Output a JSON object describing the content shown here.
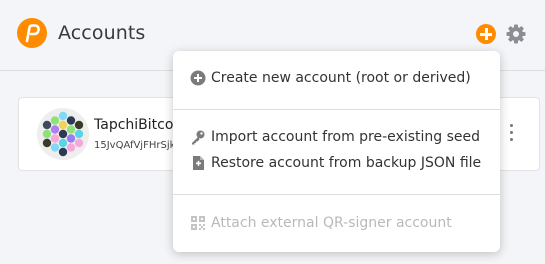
{
  "header": {
    "title": "Accounts",
    "logo_icon": "polkadot-logo-icon",
    "add_icon": "plus-circle-icon",
    "settings_icon": "gear-icon",
    "accent_color": "#ff8c00"
  },
  "account": {
    "name": "TapchiBitcoin",
    "address": "15JvQAfVjFHrSjk7",
    "identicon_icon": "polkadot-identicon-icon",
    "more_icon": "kebab-menu-icon"
  },
  "menu": {
    "create_label": "Create new account (root or derived)",
    "import_label": "Import account from pre-existing seed",
    "restore_label": "Restore account from backup JSON file",
    "attach_label": "Attach external QR-signer account"
  }
}
